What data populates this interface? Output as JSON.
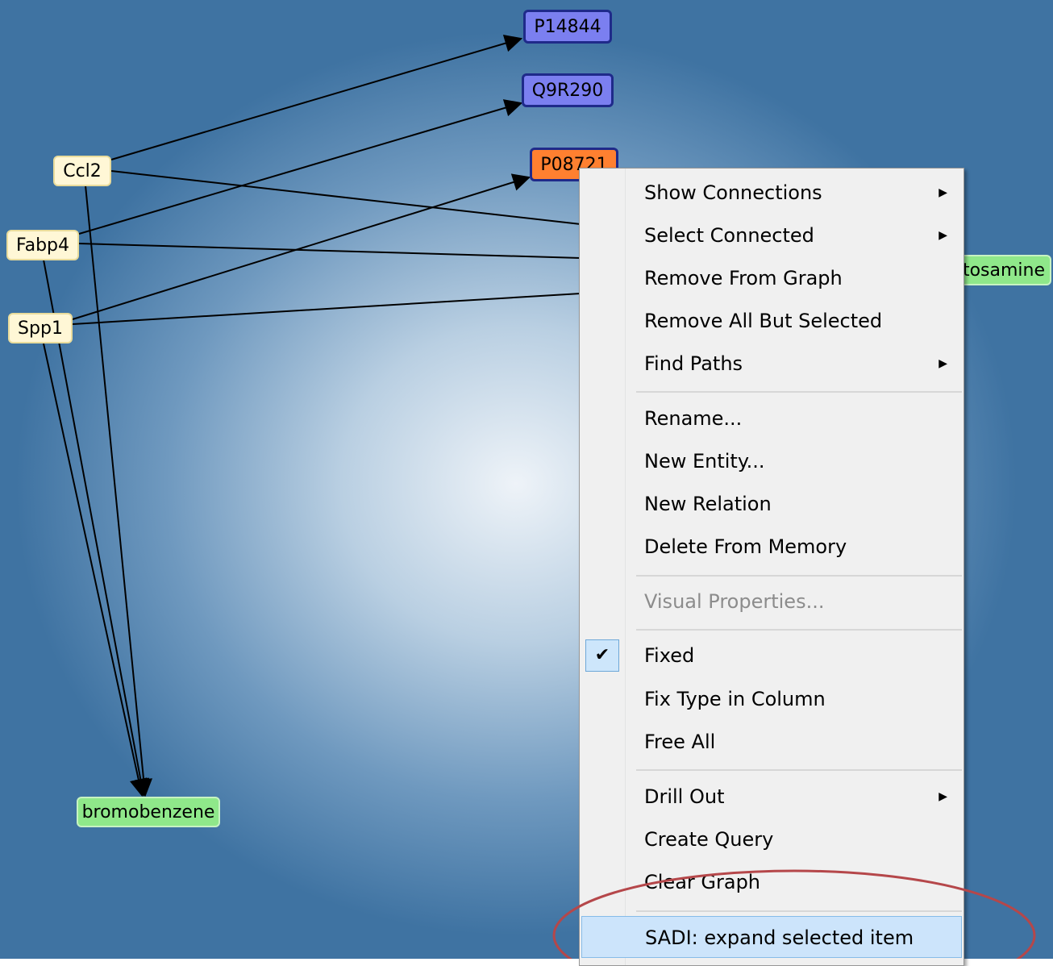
{
  "graph": {
    "nodes": {
      "ccl2": "Ccl2",
      "fabp4": "Fabp4",
      "spp1": "Spp1",
      "p14844": "P14844",
      "q9r290": "Q9R290",
      "p08721": "P08721",
      "tosamine": "tosamine",
      "bromobenzene": "bromobenzene"
    }
  },
  "context_menu": {
    "show_connections": "Show Connections",
    "select_connected": "Select Connected",
    "remove_from_graph": "Remove From Graph",
    "remove_all_but_selected": "Remove All But Selected",
    "find_paths": "Find Paths",
    "rename": "Rename...",
    "new_entity": "New Entity...",
    "new_relation": "New Relation",
    "delete_from_memory": "Delete From Memory",
    "visual_properties": "Visual Properties...",
    "fixed": "Fixed",
    "fix_type_in_column": "Fix Type in Column",
    "free_all": "Free All",
    "drill_out": "Drill Out",
    "create_query": "Create Query",
    "clear_graph": "Clear Graph",
    "sadi_expand": "SADI: expand selected item"
  },
  "colors": {
    "gene_node": "#fff7d6",
    "protein_node": "#7b7ff0",
    "selected_node": "#ff8030",
    "chemical_node": "#8fe88a",
    "annotation_ellipse": "#b5474a",
    "menu_highlight": "#cce4fb"
  },
  "icons": {
    "submenu": "submenu-arrow-icon",
    "checked": "check-icon"
  }
}
